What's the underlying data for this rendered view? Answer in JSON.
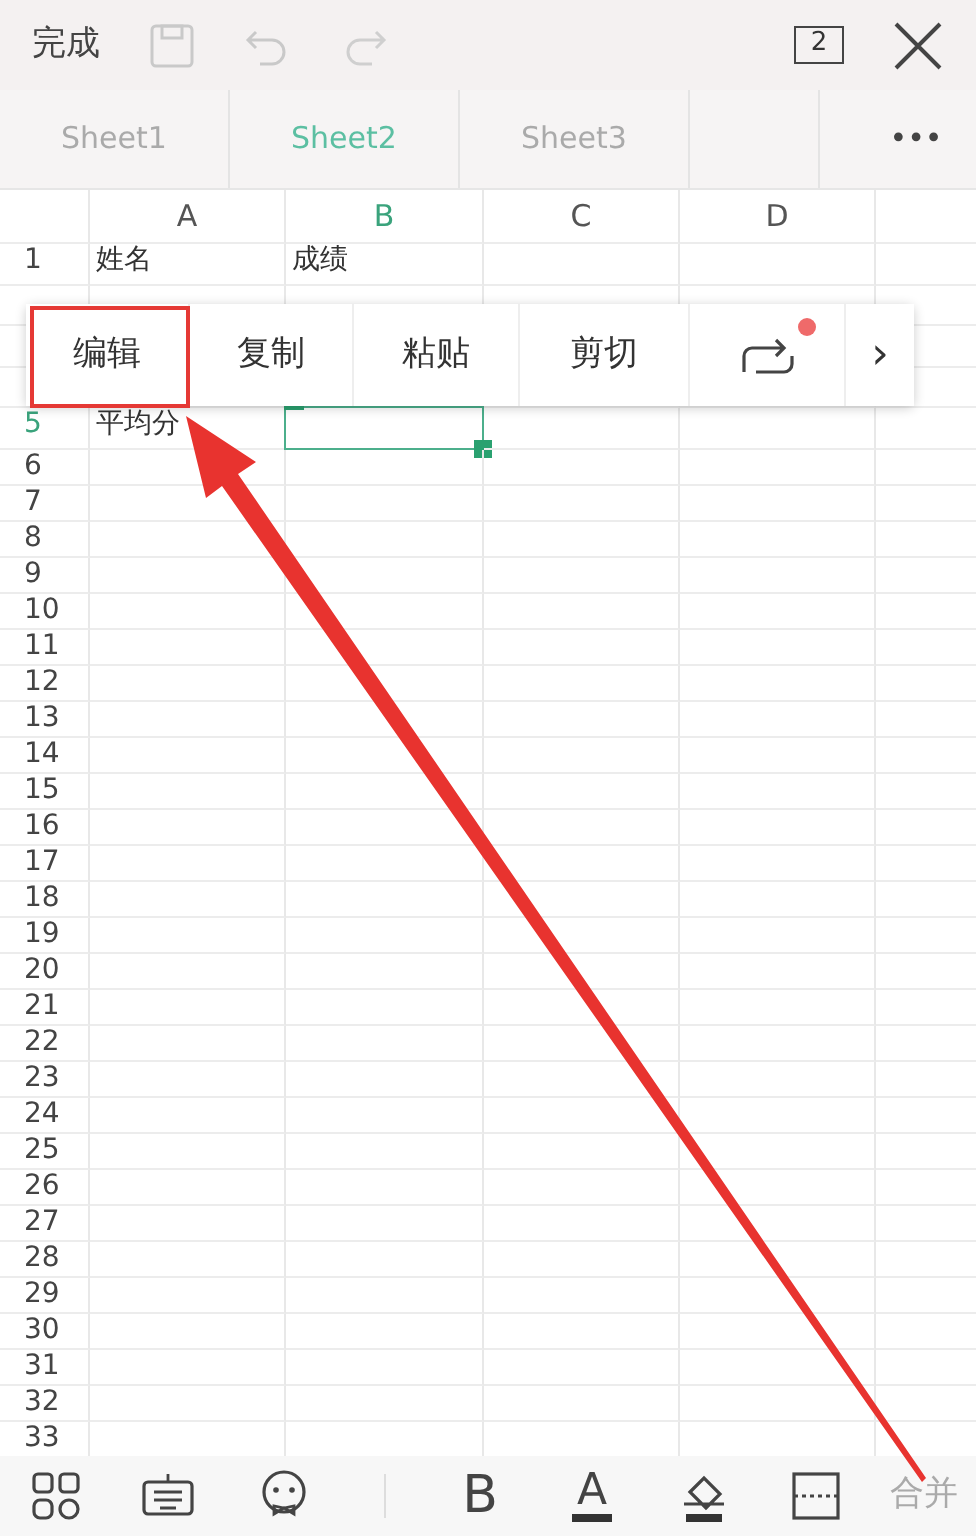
{
  "toolbar": {
    "done": "完成",
    "window_count": "2"
  },
  "sheet_tabs": [
    {
      "label": "Sheet1",
      "selected": false
    },
    {
      "label": "Sheet2",
      "selected": true
    },
    {
      "label": "Sheet3",
      "selected": false
    }
  ],
  "more_sheets": "•••",
  "columns": [
    {
      "label": "A",
      "selected": false
    },
    {
      "label": "B",
      "selected": true
    },
    {
      "label": "C",
      "selected": false
    },
    {
      "label": "D",
      "selected": false
    },
    {}
  ],
  "rows": [
    {
      "number": "1",
      "selected": false,
      "cells": [
        "姓名",
        "成绩"
      ]
    },
    {},
    {},
    {},
    {
      "number": "5",
      "selected": true,
      "cells": [
        "平均分"
      ]
    },
    {
      "number": "6",
      "selected": false
    },
    {
      "number": "7",
      "selected": false
    },
    {
      "number": "8",
      "selected": false
    },
    {
      "number": "9",
      "selected": false
    },
    {
      "number": "10",
      "selected": false
    },
    {
      "number": "11",
      "selected": false
    },
    {
      "number": "12",
      "selected": false
    },
    {
      "number": "13",
      "selected": false
    },
    {
      "number": "14",
      "selected": false
    },
    {
      "number": "15",
      "selected": false
    },
    {
      "number": "16",
      "selected": false
    },
    {
      "number": "17",
      "selected": false
    },
    {
      "number": "18",
      "selected": false
    },
    {
      "number": "19",
      "selected": false
    },
    {
      "number": "20",
      "selected": false
    },
    {
      "number": "21",
      "selected": false
    },
    {
      "number": "22",
      "selected": false
    },
    {
      "number": "23",
      "selected": false
    },
    {
      "number": "24",
      "selected": false
    },
    {
      "number": "25",
      "selected": false
    },
    {
      "number": "26",
      "selected": false
    },
    {
      "number": "27",
      "selected": false
    },
    {
      "number": "28",
      "selected": false
    },
    {
      "number": "29",
      "selected": false
    },
    {
      "number": "30",
      "selected": false
    },
    {
      "number": "31",
      "selected": false
    },
    {
      "number": "32",
      "selected": false
    },
    {
      "number": "33",
      "selected": false
    }
  ],
  "context_menu": [
    {
      "kind": "text",
      "label": "编辑",
      "highlighted": true
    },
    {
      "kind": "text",
      "label": "复制",
      "highlighted": false
    },
    {
      "kind": "text",
      "label": "粘贴",
      "highlighted": false
    },
    {
      "kind": "text",
      "label": "剪切",
      "highlighted": false
    },
    {
      "kind": "share",
      "badge": true
    },
    {
      "kind": "next",
      "label": "›"
    }
  ],
  "bottom_tools": [
    {
      "kind": "apps"
    },
    {
      "kind": "keyboard"
    },
    {
      "kind": "emoji"
    },
    {
      "kind": "divider"
    },
    {
      "kind": "letter",
      "label": "B"
    },
    {
      "kind": "font-color",
      "label": "A"
    },
    {
      "kind": "fill"
    },
    {
      "kind": "border"
    },
    {
      "kind": "letter",
      "label": "合并"
    }
  ]
}
